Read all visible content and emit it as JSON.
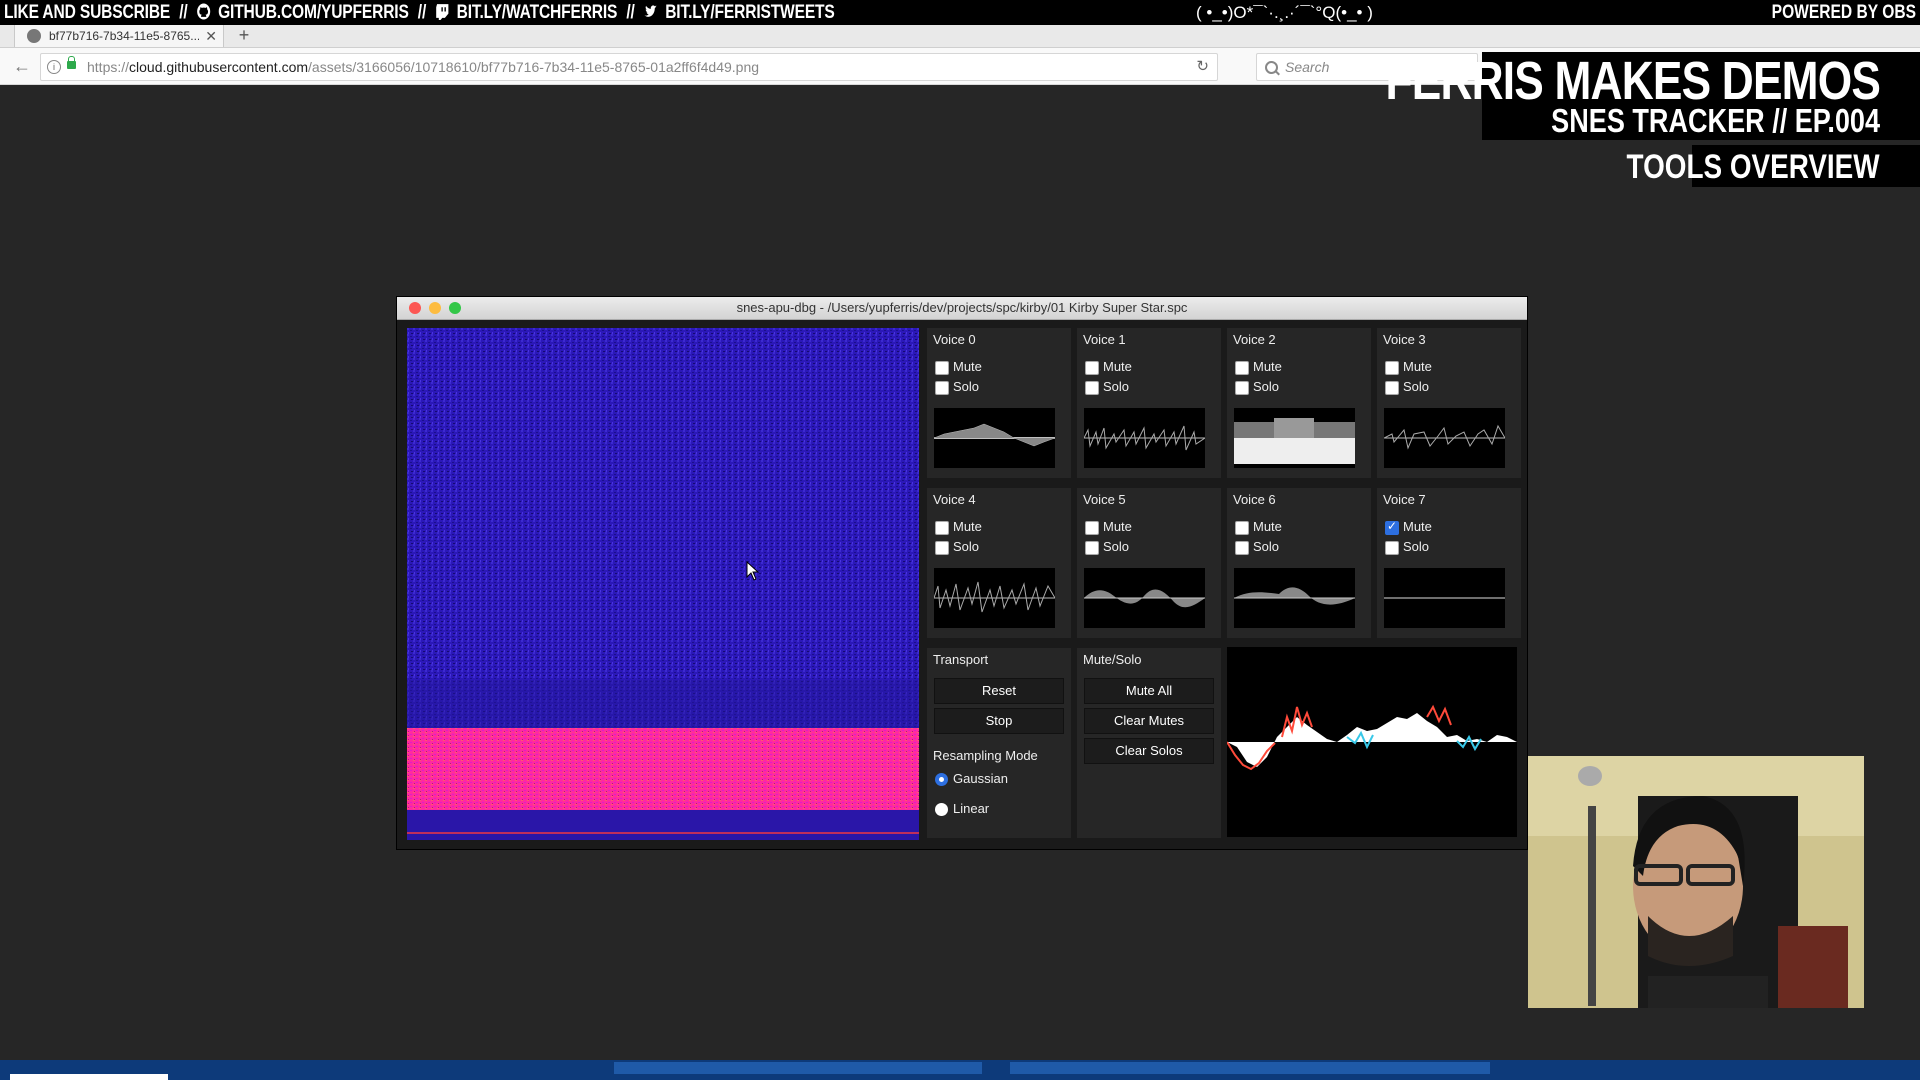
{
  "ticker": {
    "left_1": "LIKE AND SUBSCRIBE",
    "left_2": "GITHUB.COM/YUPFERRIS",
    "left_3": "BIT.LY/WATCHFERRIS",
    "left_4": "BIT.LY/FERRISTWEETS",
    "separator": "//",
    "middle": "( •_•)O*¯`·.¸.·´¯`°Q(•_• )",
    "right": "POWERED BY OBS"
  },
  "browser": {
    "tab_title": "bf77b716-7b34-11e5-8765...",
    "tab_close": "✕",
    "new_tab": "+",
    "back": "←",
    "url_prefix": "https://",
    "url_host": "cloud.githubusercontent.com",
    "url_path": "/assets/3166056/10718610/bf77b716-7b34-11e5-8765-01a2ff6f4d49.png",
    "reload": "↻",
    "search_placeholder": "Search"
  },
  "overlay": {
    "title": "FERRIS MAKES DEMOS",
    "subtitle": "SNES TRACKER // EP.004",
    "topic": "TOOLS OVERVIEW"
  },
  "window": {
    "title": "snes-apu-dbg - /Users/yupferris/dev/projects/spc/kirby/01 Kirby Super Star.spc",
    "colors": {
      "close": "#fc5753",
      "minimize": "#fdbc40",
      "zoom": "#33c748"
    }
  },
  "voices": [
    {
      "name": "Voice 0",
      "mute_label": "Mute",
      "solo_label": "Solo",
      "mute": false,
      "solo": false
    },
    {
      "name": "Voice 1",
      "mute_label": "Mute",
      "solo_label": "Solo",
      "mute": false,
      "solo": false
    },
    {
      "name": "Voice 2",
      "mute_label": "Mute",
      "solo_label": "Solo",
      "mute": false,
      "solo": false
    },
    {
      "name": "Voice 3",
      "mute_label": "Mute",
      "solo_label": "Solo",
      "mute": false,
      "solo": false
    },
    {
      "name": "Voice 4",
      "mute_label": "Mute",
      "solo_label": "Solo",
      "mute": false,
      "solo": false
    },
    {
      "name": "Voice 5",
      "mute_label": "Mute",
      "solo_label": "Solo",
      "mute": false,
      "solo": false
    },
    {
      "name": "Voice 6",
      "mute_label": "Mute",
      "solo_label": "Solo",
      "mute": false,
      "solo": false
    },
    {
      "name": "Voice 7",
      "mute_label": "Mute",
      "solo_label": "Solo",
      "mute": true,
      "solo": false
    }
  ],
  "transport": {
    "title": "Transport",
    "reset": "Reset",
    "stop": "Stop",
    "resampling_title": "Resampling Mode",
    "gaussian": "Gaussian",
    "linear": "Linear",
    "selected_mode": "Gaussian"
  },
  "mutesolo": {
    "title": "Mute/Solo",
    "mute_all": "Mute All",
    "clear_mutes": "Clear Mutes",
    "clear_solos": "Clear Solos"
  },
  "icons": {
    "github": "github-icon",
    "twitch": "twitch-icon",
    "twitter": "twitter-icon"
  }
}
